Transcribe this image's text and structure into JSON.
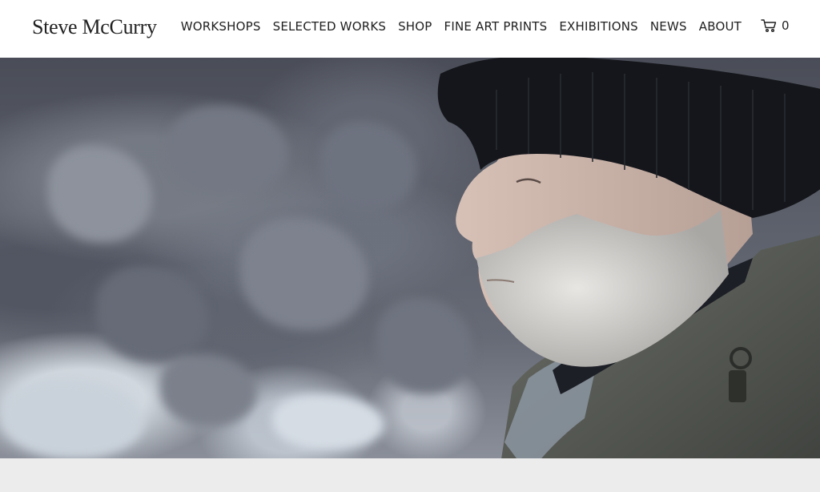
{
  "header": {
    "logo_text": "Steve McCurry",
    "nav": [
      {
        "label": "WORKSHOPS"
      },
      {
        "label": "SELECTED WORKS"
      },
      {
        "label": "SHOP"
      },
      {
        "label": "FINE ART PRINTS"
      },
      {
        "label": "EXHIBITIONS"
      },
      {
        "label": "NEWS"
      },
      {
        "label": "ABOUT"
      }
    ],
    "cart": {
      "icon": "cart-icon",
      "count": "0"
    }
  },
  "hero": {
    "image": "hero-photo-man-in-beanie"
  }
}
